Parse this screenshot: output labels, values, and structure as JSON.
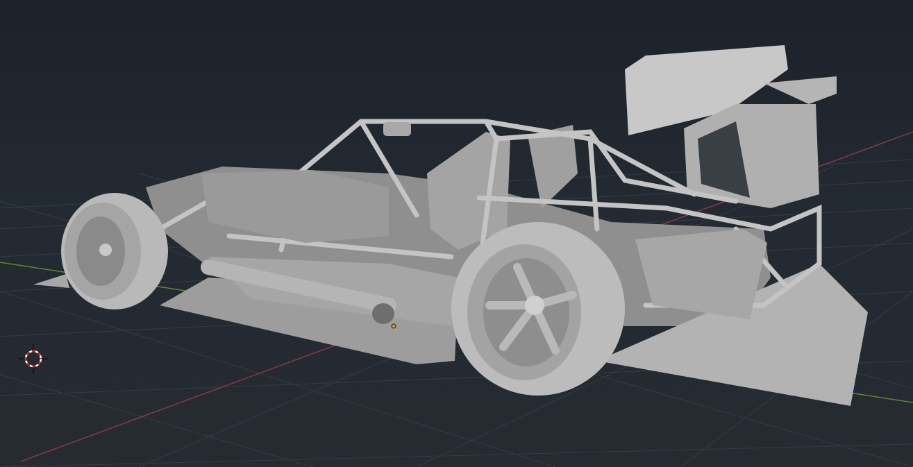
{
  "viewport": {
    "background_color": "#232a32",
    "grid_color": "#3a4049",
    "x_axis_color": "#8a3a45",
    "y_axis_color": "#5d8a2e",
    "model_color": "#bdbdbd",
    "model_shadow_color": "#8c8c8c",
    "origin_color": "#f08a24",
    "icons": [
      "3d-cursor-icon",
      "object-origin-icon"
    ]
  }
}
